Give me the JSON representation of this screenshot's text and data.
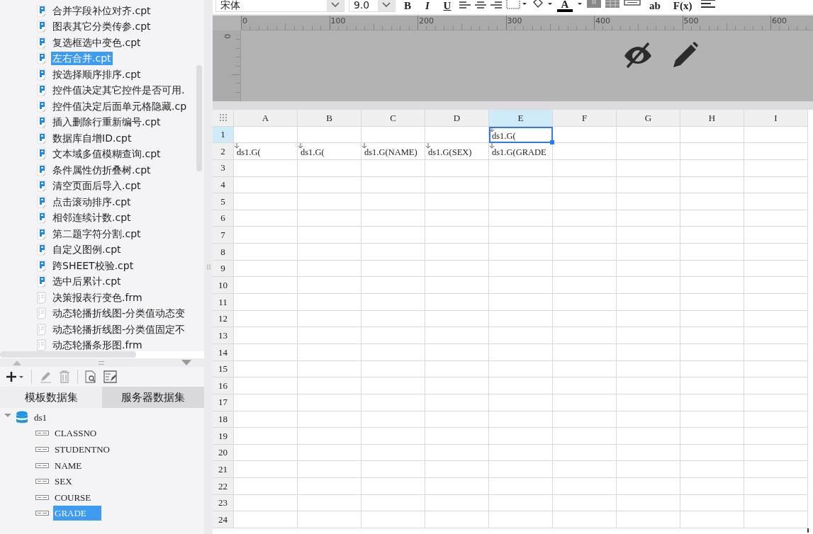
{
  "toolbar": {
    "font": "宋体",
    "size": "9.0",
    "format_buttons": [
      "B",
      "I",
      "U"
    ],
    "font_color_label": "A",
    "text_tools": [
      "ab",
      "F(x)"
    ]
  },
  "files": [
    {
      "name": "合并字段补位对齐.cpt",
      "kind": "cpt",
      "selected": false
    },
    {
      "name": "图表其它分类传参.cpt",
      "kind": "cpt",
      "selected": false
    },
    {
      "name": "复选框选中变色.cpt",
      "kind": "cpt",
      "selected": false
    },
    {
      "name": "左右合并.cpt",
      "kind": "cpt",
      "selected": true
    },
    {
      "name": "按选择顺序排序.cpt",
      "kind": "cpt",
      "selected": false
    },
    {
      "name": "控件值决定其它控件是否可用.",
      "kind": "cpt",
      "selected": false
    },
    {
      "name": "控件值决定后面单元格隐藏.cp",
      "kind": "cpt",
      "selected": false
    },
    {
      "name": "插入删除行重新编号.cpt",
      "kind": "cpt",
      "selected": false
    },
    {
      "name": "数据库自增ID.cpt",
      "kind": "cpt",
      "selected": false
    },
    {
      "name": "文本域多值模糊查询.cpt",
      "kind": "cpt",
      "selected": false
    },
    {
      "name": "条件属性仿折叠树.cpt",
      "kind": "cpt",
      "selected": false
    },
    {
      "name": "清空页面后导入.cpt",
      "kind": "cpt",
      "selected": false
    },
    {
      "name": "点击滚动排序.cpt",
      "kind": "cpt",
      "selected": false
    },
    {
      "name": "相邻连续计数.cpt",
      "kind": "cpt",
      "selected": false
    },
    {
      "name": "第二题字符分割.cpt",
      "kind": "cpt",
      "selected": false
    },
    {
      "name": "自定义图例.cpt",
      "kind": "cpt",
      "selected": false
    },
    {
      "name": "跨SHEET校验.cpt",
      "kind": "cpt",
      "selected": false
    },
    {
      "name": "选中后累计.cpt",
      "kind": "cpt",
      "selected": false
    },
    {
      "name": "决策报表行变色.frm",
      "kind": "frm",
      "selected": false
    },
    {
      "name": "动态轮播折线图-分类值动态变",
      "kind": "frm",
      "selected": false
    },
    {
      "name": "动态轮播折线图-分类值固定不",
      "kind": "frm",
      "selected": false
    },
    {
      "name": "动态轮播条形图.frm",
      "kind": "frm",
      "selected": false
    }
  ],
  "dataset_tabs": [
    {
      "label": "模板数据集",
      "selected": true
    },
    {
      "label": "服务器数据集",
      "selected": false
    }
  ],
  "datasets": [
    {
      "name": "ds1",
      "expanded": true,
      "children": [
        {
          "name": "CLASSNO",
          "selected": false
        },
        {
          "name": "STUDENTNO",
          "selected": false
        },
        {
          "name": "NAME",
          "selected": false
        },
        {
          "name": "SEX",
          "selected": false
        },
        {
          "name": "COURSE",
          "selected": false
        },
        {
          "name": "GRADE",
          "selected": true
        }
      ]
    }
  ],
  "ruler": {
    "marks": [
      "0",
      "100",
      "200",
      "300",
      "400",
      "500",
      "600"
    ],
    "vertical_mark": "0"
  },
  "grid": {
    "columns": [
      {
        "label": "A",
        "selected": false
      },
      {
        "label": "B",
        "selected": false
      },
      {
        "label": "C",
        "selected": false
      },
      {
        "label": "D",
        "selected": false
      },
      {
        "label": "E",
        "selected": true
      },
      {
        "label": "F",
        "selected": false
      },
      {
        "label": "G",
        "selected": false
      },
      {
        "label": "H",
        "selected": false
      },
      {
        "label": "I",
        "selected": false
      }
    ],
    "rows": [
      {
        "label": "1",
        "selected": true,
        "cells": [
          {},
          {},
          {},
          {},
          {
            "text": "ds1.G(",
            "expands": true,
            "selected": true
          }
        ]
      },
      {
        "label": "2",
        "selected": false,
        "cells": [
          {
            "text": "ds1.G(",
            "expands": true
          },
          {
            "text": "ds1.G(",
            "expands": true
          },
          {
            "text": "ds1.G(NAME)",
            "expands": true
          },
          {
            "text": "ds1.G(SEX)",
            "expands": true
          },
          {
            "text": "ds1.G(GRADE",
            "expands": true
          }
        ]
      },
      {
        "label": "3",
        "selected": false
      },
      {
        "label": "4",
        "selected": false
      },
      {
        "label": "5",
        "selected": false
      },
      {
        "label": "6",
        "selected": false
      },
      {
        "label": "7",
        "selected": false
      },
      {
        "label": "8",
        "selected": false
      },
      {
        "label": "9",
        "selected": false
      },
      {
        "label": "10",
        "selected": false
      },
      {
        "label": "11",
        "selected": false
      },
      {
        "label": "12",
        "selected": false
      },
      {
        "label": "13",
        "selected": false
      },
      {
        "label": "14",
        "selected": false
      },
      {
        "label": "15",
        "selected": false
      },
      {
        "label": "16",
        "selected": false
      },
      {
        "label": "17",
        "selected": false
      },
      {
        "label": "18",
        "selected": false
      },
      {
        "label": "19",
        "selected": false
      },
      {
        "label": "20",
        "selected": false
      },
      {
        "label": "21",
        "selected": false
      },
      {
        "label": "22",
        "selected": false
      },
      {
        "label": "23",
        "selected": false
      },
      {
        "label": "24",
        "selected": false
      }
    ]
  }
}
